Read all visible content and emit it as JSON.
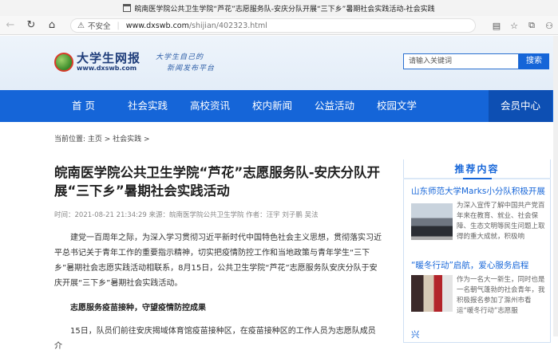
{
  "browser": {
    "tab_title": "皖南医学院公共卫生学院“芦花”志愿服务队-安庆分队开展“三下乡”暑期社会实践活动-社会实践",
    "security_label": "不安全",
    "url_host": "www.dxswb.com",
    "url_path": "/shijian/402323.html"
  },
  "header": {
    "logo_cn": "大学生网报",
    "logo_url": "www.dxswb.com",
    "slogan_line1": "大学生自己的",
    "slogan_line2": "新闻发布平台",
    "search_placeholder": "请输入关键词",
    "search_button": "搜索"
  },
  "nav": {
    "items": [
      "首 页",
      "社会实践",
      "高校资讯",
      "校内新闻",
      "公益活动",
      "校园文学"
    ],
    "member": "会员中心"
  },
  "breadcrumb": "当前位置: 主页 > 社会实践 >",
  "article": {
    "title": "皖南医学院公共卫生学院“芦花”志愿服务队-安庆分队开展“三下乡”暑期社会实践活动",
    "meta": "时间：2021-08-21 21:34:29 来源：皖南医学院公共卫生学院 作者：汪宇 刘子鹏 吴法",
    "para1": "建党一百周年之际，为深入学习贯彻习近平新时代中国特色社会主义思想，贯彻落实习近平总书记关于青年工作的重要指示精神，切实把疫情防控工作和当地政策与青年学生“三下乡”暑期社会志愿实践活动相联系，8月15日，公共卫生学院“芦花”志愿服务队安庆分队于安庆开展“三下乡”暑期社会实践活动。",
    "subhead": "志愿服务疫苗接种，守望疫情防控成果",
    "para2": "15日，队员们前往安庆揭域体育馆疫苗接种区，在疫苗接种区的工作人员为志愿队成员介"
  },
  "sidebar": {
    "heading": "推荐内容",
    "items": [
      {
        "title": "山东师范大学Marks小分队积极开展",
        "desc": "为深入宣传了解中国共产党百年来在教育、就业、社会保障、生态文明等民生问题上取得的重大成就，积极响"
      },
      {
        "title": "“暖冬行动”启航，爱心服务启程",
        "desc": "作为一名大一新生，同时也是一名朝气蓬勃的社会青年，我积极报名参加了滁州市看运“暖冬行动”志愿服"
      },
      {
        "title": "兴"
      }
    ]
  },
  "colors": {
    "brand_blue": "#1565d8",
    "member_blue": "#0d4fb3"
  }
}
